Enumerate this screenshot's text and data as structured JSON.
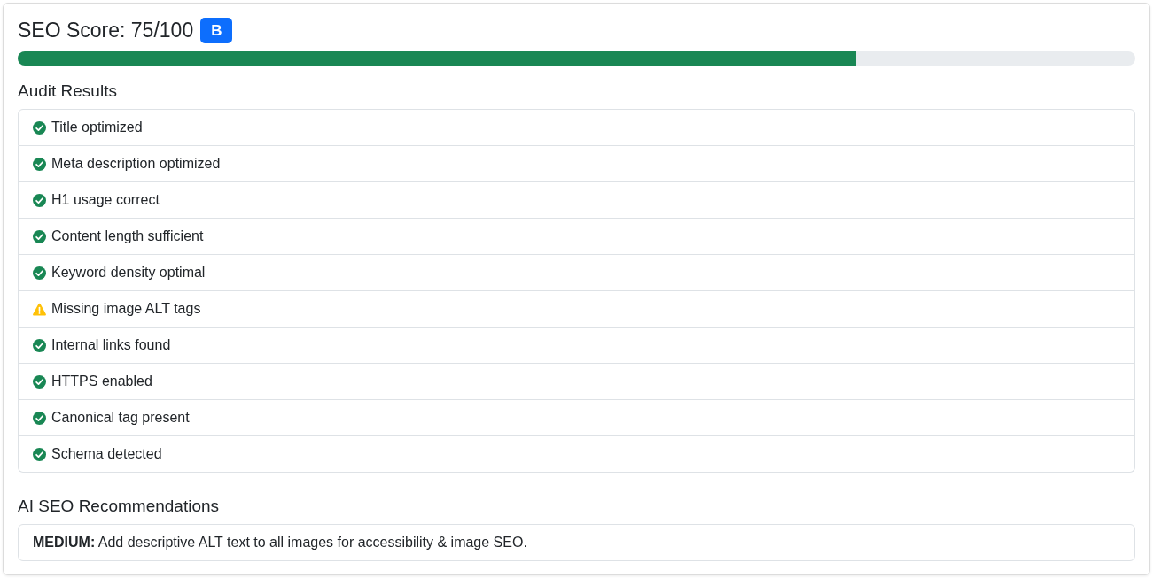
{
  "score": {
    "title": "SEO Score: 75/100",
    "grade": "B",
    "level": 0.75
  },
  "audit": {
    "heading": "Audit Results",
    "items": [
      {
        "label": "Title optimized",
        "kind": "pass"
      },
      {
        "label": "Meta description optimized",
        "kind": "pass"
      },
      {
        "label": "H1 usage correct",
        "kind": "pass"
      },
      {
        "label": "Content length sufficient",
        "kind": "pass"
      },
      {
        "label": "Keyword density optimal",
        "kind": "pass"
      },
      {
        "label": "Missing image ALT tags",
        "kind": "warning"
      },
      {
        "label": "Internal links found",
        "kind": "pass"
      },
      {
        "label": "HTTPS enabled",
        "kind": "pass"
      },
      {
        "label": "Canonical tag present",
        "kind": "pass"
      },
      {
        "label": "Schema detected",
        "kind": "pass"
      }
    ]
  },
  "recommendations": {
    "heading": "AI SEO Recommendations",
    "items": [
      {
        "text": "**MEDIUM:** Add descriptive ALT text to all images for accessibility & image SEO."
      }
    ]
  }
}
